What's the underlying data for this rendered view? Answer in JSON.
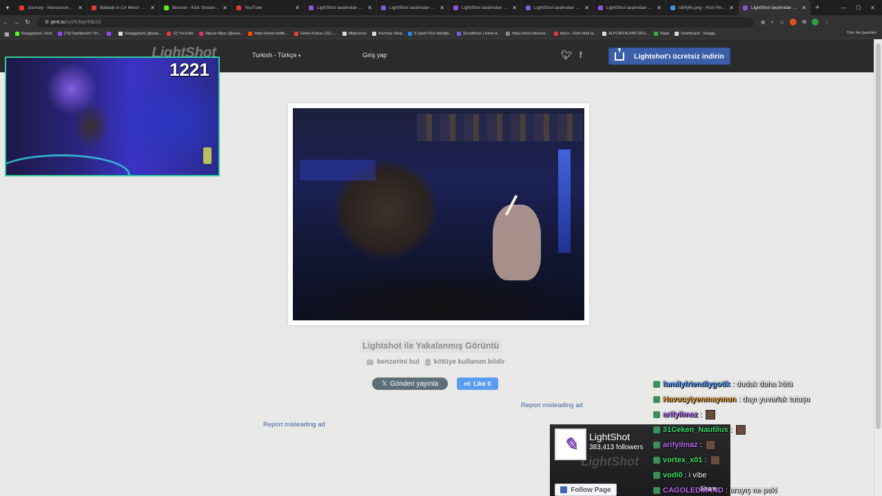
{
  "browser": {
    "tabs": [
      {
        "title": "Journey - Nescence/Apo...",
        "favicon": "#e53935",
        "active": false
      },
      {
        "title": "Ballade in C# Minor: Co...",
        "favicon": "#e53935",
        "active": false
      },
      {
        "title": "Browse - Kick Streaming",
        "favicon": "#53fc18",
        "active": false
      },
      {
        "title": "YouTube",
        "favicon": "#e53935",
        "active": false
      },
      {
        "title": "LightShot tarafından Ekr...",
        "favicon": "#8a56d6",
        "active": false
      },
      {
        "title": "LightShot tarafından Ekr...",
        "favicon": "#8a56d6",
        "active": false
      },
      {
        "title": "LightShot tarafından Ekr...",
        "favicon": "#8a56d6",
        "active": false
      },
      {
        "title": "LightShot tarafından Ekr...",
        "favicon": "#8a56d6",
        "active": false
      },
      {
        "title": "LightShot tarafından Ekr...",
        "favicon": "#8a56d6",
        "active": false
      },
      {
        "title": "ld5hj6k.png - Hızlı Resim",
        "favicon": "#4a90e2",
        "active": false
      },
      {
        "title": "LightShot tarafından Ekr...",
        "favicon": "#8a56d6",
        "active": true
      }
    ],
    "url_host": "prnt.sc",
    "url_path": "/cyZK3spHSb1D",
    "bookmarks": [
      {
        "label": "Swaggybark | Kick",
        "color": "#53fc18"
      },
      {
        "label": "(79) Dashboard / Str...",
        "color": "#9146ff"
      },
      {
        "label": "",
        "color": "#9146ff"
      },
      {
        "label": "Swaggybark (@swa...",
        "color": "#dddddd"
      },
      {
        "label": "(2) YouTube",
        "color": "#e53935"
      },
      {
        "label": "Alpcan Alpar (@swa...",
        "color": "#e1306c"
      },
      {
        "label": "https://www.reddit....",
        "color": "#ff4500"
      },
      {
        "label": "Gelen Kutusu (31) -...",
        "color": "#ea4335"
      },
      {
        "label": "Midjourney",
        "color": "#dddddd"
      },
      {
        "label": "Konfuse Shop",
        "color": "#dddddd"
      },
      {
        "label": "S Sport Plus-İstediği...",
        "color": "#1e88e5"
      },
      {
        "label": "Excalidraw | Hand-d...",
        "color": "#6965db"
      },
      {
        "label": "https://next.inkarnat...",
        "color": "#888888"
      },
      {
        "label": "Inbox - Zoho Mail (a...",
        "color": "#e53935"
      },
      {
        "label": "ALPCAN ALPAR DEV...",
        "color": "#dddddd"
      },
      {
        "label": "Maps",
        "color": "#34a853"
      },
      {
        "label": "Dashboard - Swagg...",
        "color": "#dddddd"
      }
    ],
    "all_bookmarks": "Tüm Yer İşaretleri"
  },
  "lightshot": {
    "logo": "LightShot",
    "language": "Turkish - Türkçe",
    "login": "Giriş yap",
    "download_button": "Lightshot'ı ücretsiz indirin",
    "caption": "Lightshot ile Yakalanmış Görüntü",
    "find_similar": "benzerini bul",
    "report_abuse": "kötüye kullanım bildir",
    "tweet_button": "Gönderi yayınla",
    "like_button": "Like 0",
    "report_ad_1": "Report misleading ad",
    "report_ad_2": "Report misleading ad"
  },
  "facebook_widget": {
    "page_name": "LightShot",
    "followers": "383,413 followers",
    "watermark": "LightShot",
    "follow_button": "Follow Page",
    "share": "Share"
  },
  "stream_overlay": {
    "viewer_count": "1221",
    "chat": [
      {
        "user": "familyfriendlygotik",
        "color": "#5aa0ff",
        "text": "dudak daha kötü",
        "emote": false
      },
      {
        "user": "Havucyiyenmaymun",
        "color": "#e8a23c",
        "text": "dayı yuvarlak tutuşu",
        "emote": false
      },
      {
        "user": "arifyilmaz",
        "color": "#b76cf0",
        "text": "",
        "emote": true
      },
      {
        "user": "31Ceken_Nautilus",
        "color": "#3ee06a",
        "text": "",
        "emote": true
      },
      {
        "user": "arifyilmaz",
        "color": "#b76cf0",
        "text": "",
        "emote": true
      },
      {
        "user": "vortex_x01",
        "color": "#3ee06a",
        "text": "",
        "emote": true
      },
      {
        "user": "vodi0",
        "color": "#3ee06a",
        "text": "i vibe",
        "emote": false
      },
      {
        "user": "CAGOLEDMAND",
        "color": "#b76cf0",
        "text": "arayış ne peki",
        "emote": false
      }
    ]
  }
}
